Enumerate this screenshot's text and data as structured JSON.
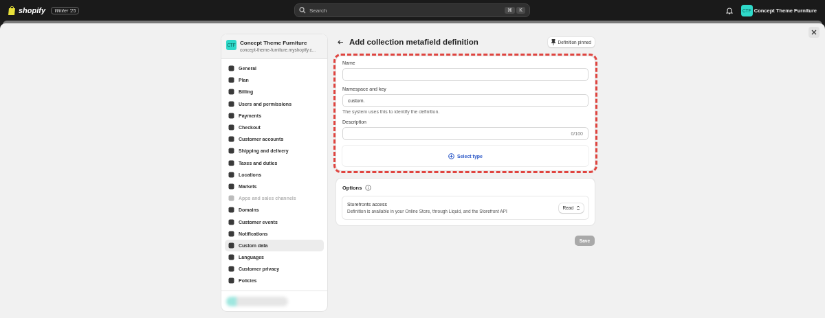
{
  "topbar": {
    "logo": "shopify",
    "release_badge": "Winter '25",
    "search": {
      "placeholder": "Search",
      "shortcut": [
        "⌘",
        "K"
      ]
    },
    "store_avatar": "CTF",
    "store_name": "Concept Theme Furniture"
  },
  "sidebar": {
    "store": {
      "avatar": "CTF",
      "name": "Concept Theme Furniture",
      "domain": "concept-theme-furniture.myshopify.c..."
    },
    "items": [
      {
        "label": "General",
        "selected": false,
        "disabled": false
      },
      {
        "label": "Plan",
        "selected": false,
        "disabled": false
      },
      {
        "label": "Billing",
        "selected": false,
        "disabled": false
      },
      {
        "label": "Users and permissions",
        "selected": false,
        "disabled": false
      },
      {
        "label": "Payments",
        "selected": false,
        "disabled": false
      },
      {
        "label": "Checkout",
        "selected": false,
        "disabled": false
      },
      {
        "label": "Customer accounts",
        "selected": false,
        "disabled": false
      },
      {
        "label": "Shipping and delivery",
        "selected": false,
        "disabled": false
      },
      {
        "label": "Taxes and duties",
        "selected": false,
        "disabled": false
      },
      {
        "label": "Locations",
        "selected": false,
        "disabled": false
      },
      {
        "label": "Markets",
        "selected": false,
        "disabled": false
      },
      {
        "label": "Apps and sales channels",
        "selected": false,
        "disabled": true
      },
      {
        "label": "Domains",
        "selected": false,
        "disabled": false
      },
      {
        "label": "Customer events",
        "selected": false,
        "disabled": false
      },
      {
        "label": "Notifications",
        "selected": false,
        "disabled": false
      },
      {
        "label": "Custom data",
        "selected": true,
        "disabled": false
      },
      {
        "label": "Languages",
        "selected": false,
        "disabled": false
      },
      {
        "label": "Customer privacy",
        "selected": false,
        "disabled": false
      },
      {
        "label": "Policies",
        "selected": false,
        "disabled": false
      }
    ]
  },
  "page": {
    "title": "Add collection metafield definition",
    "pin_button": "Definition pinned",
    "form": {
      "highlighted": true,
      "fields": [
        {
          "label": "Name"
        },
        {
          "label": "Namespace and key",
          "value": "custom.",
          "help": "The system uses this to identify the definition."
        },
        {
          "label": "Description",
          "counter": "0/100"
        }
      ],
      "select_type": "Select type"
    },
    "options": {
      "title": "Options",
      "rows": [
        {
          "title": "Storefronts access",
          "description": "Definition is available in your Online Store, through Liquid, and the Storefront API",
          "select": "Read"
        }
      ]
    },
    "save_button": {
      "label": "Save",
      "disabled": true
    }
  }
}
